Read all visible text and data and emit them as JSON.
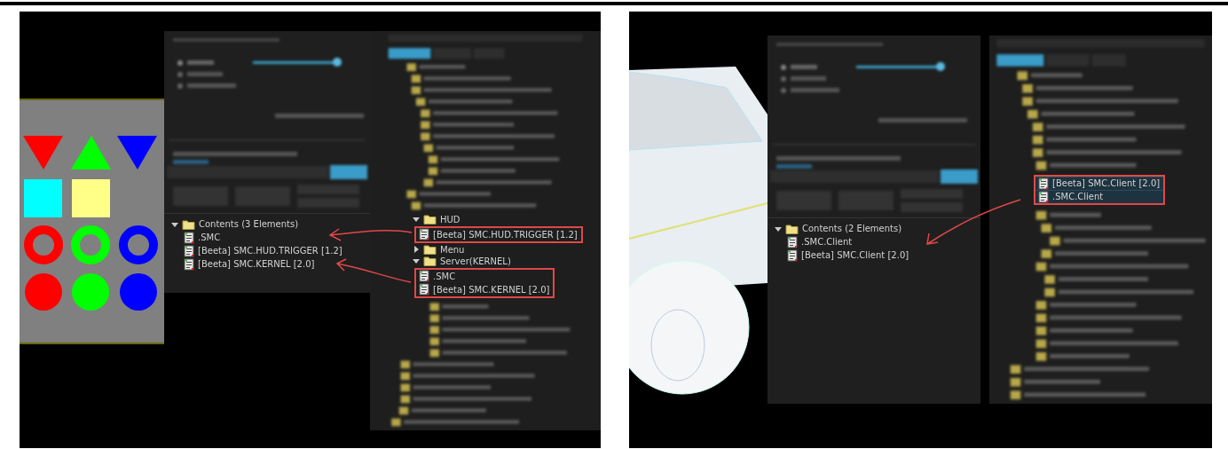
{
  "panels": [
    {
      "scene": {
        "kind": "shapes"
      },
      "contents": {
        "title": "Contents (3 Elements)",
        "expanded": true,
        "items": [
          {
            "label": ".SMC"
          },
          {
            "label": "[Beeta] SMC.HUD.TRIGGER [1.2]"
          },
          {
            "label": "[Beeta] SMC.KERNEL [2.0]"
          }
        ]
      },
      "inventory": {
        "rows": [
          {
            "kind": "folder",
            "label": "HUD",
            "expanded": true
          },
          {
            "kind": "boxed",
            "items": [
              {
                "label": "[Beeta] SMC.HUD.TRIGGER [1.2]",
                "selected": false
              }
            ]
          },
          {
            "kind": "folder",
            "label": "Menu",
            "expanded": false
          },
          {
            "kind": "folder",
            "label": "Server(KERNEL)",
            "expanded": true
          },
          {
            "kind": "boxed",
            "items": [
              {
                "label": ".SMC",
                "selected": false
              },
              {
                "label": "[Beeta] SMC.KERNEL [2.0]",
                "selected": false
              }
            ]
          }
        ]
      }
    },
    {
      "scene": {
        "kind": "car"
      },
      "contents": {
        "title": "Contents (2 Elements)",
        "expanded": true,
        "items": [
          {
            "label": ".SMC.Client"
          },
          {
            "label": "[Beeta] SMC.Client [2.0]"
          }
        ]
      },
      "inventory": {
        "rows": [
          {
            "kind": "boxed",
            "items": [
              {
                "label": "[Beeta] SMC.Client [2.0]",
                "selected": true
              },
              {
                "label": ".SMC.Client",
                "selected": true
              }
            ]
          }
        ]
      }
    }
  ]
}
